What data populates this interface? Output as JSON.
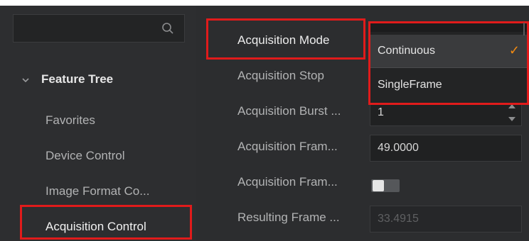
{
  "sidebar": {
    "search_placeholder": "",
    "tree_title": "Feature Tree",
    "items": [
      {
        "label": "Favorites"
      },
      {
        "label": "Device Control"
      },
      {
        "label": "Image Format Co..."
      },
      {
        "label": "Acquisition Control",
        "selected": true
      }
    ]
  },
  "properties": [
    {
      "label": "Acquisition Mode",
      "value": ""
    },
    {
      "label": "Acquisition Stop",
      "value": ""
    },
    {
      "label": "Acquisition Burst ...",
      "value": "1"
    },
    {
      "label": "Acquisition Fram...",
      "value": "49.0000"
    },
    {
      "label": "Acquisition Fram...",
      "value": "off"
    },
    {
      "label": "Resulting Frame ...",
      "value": "33.4915"
    }
  ],
  "dropdown": {
    "options": [
      {
        "label": "Continuous",
        "checked": true
      },
      {
        "label": "SingleFrame",
        "checked": false
      }
    ],
    "check_symbol": "✓"
  },
  "colors": {
    "highlight_outline": "#e01b1b",
    "check": "#f08a12",
    "background": "#2f3031"
  },
  "icons": [
    "search-icon",
    "chevron-down-icon",
    "check-icon",
    "spin-up-icon",
    "spin-down-icon"
  ]
}
